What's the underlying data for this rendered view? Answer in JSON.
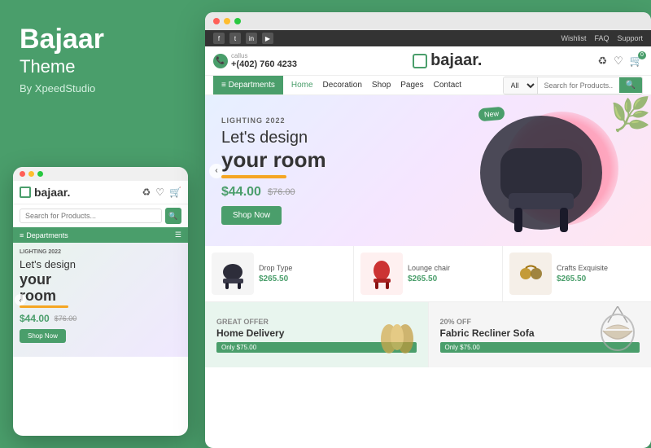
{
  "left_panel": {
    "brand": "Bajaar",
    "theme_label": "Theme",
    "by_label": "By XpeedStudio"
  },
  "mobile": {
    "logo": "bajaar.",
    "search_placeholder": "Search for Products...",
    "dept_label": "Departments",
    "hero_tag": "LIGHTING 2022",
    "hero_line1": "Let's design",
    "hero_line2": "your",
    "hero_line3": "room",
    "price": "$44.00",
    "old_price": "$76.00",
    "shop_btn": "Shop Now"
  },
  "browser": {
    "social": {
      "icons": [
        "f",
        "t",
        "in",
        "yt"
      ],
      "links": [
        "Wishlist",
        "FAQ",
        "Support"
      ]
    },
    "header": {
      "call_label": "callus",
      "phone": "+(402) 760 4233",
      "logo": "bajaar.",
      "icons": [
        "♻",
        "♡",
        "🛒"
      ]
    },
    "nav": {
      "dept_btn": "≡ Departments",
      "links": [
        "Home",
        "Decoration",
        "Shop",
        "Pages",
        "Contact"
      ],
      "search_placeholder": "Search for Products...",
      "search_all": "All"
    },
    "hero": {
      "tag": "LIGHTING",
      "year": "2022",
      "line1": "Let's design",
      "line2": "your room",
      "price": "$44.00",
      "old_price": "$76.00",
      "shop_btn": "Shop Now",
      "new_badge": "New"
    },
    "products": [
      {
        "name": "Drop Type",
        "price": "$265.50",
        "emoji": "🪑"
      },
      {
        "name": "Lounge chair",
        "price": "$265.50",
        "emoji": "🪑"
      },
      {
        "name": "Crafts Exquisite",
        "price": "$265.50",
        "emoji": "📿"
      }
    ],
    "banners": [
      {
        "label": "Great Offer",
        "title": "Home Delivery",
        "badge": "Only $75.00",
        "bg": "green-bg",
        "emoji": "🏺"
      },
      {
        "label": "20% off",
        "title": "Fabric Recliner Sofa",
        "badge": "Only $75.00",
        "bg": "light-bg",
        "emoji": "🪑"
      }
    ]
  },
  "colors": {
    "primary": "#4a9e6b",
    "accent": "#f5a623",
    "text_dark": "#333",
    "text_muted": "#999"
  }
}
